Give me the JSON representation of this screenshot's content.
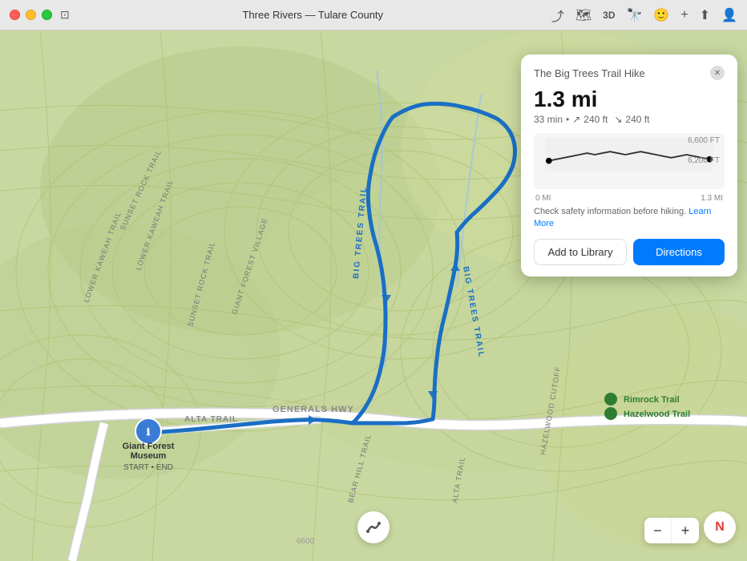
{
  "titlebar": {
    "title": "Three Rivers — Tulare County",
    "window_icon": "📄"
  },
  "toolbar": {
    "icons": [
      "location-arrow",
      "map-icon",
      "3d-icon",
      "binoculars-icon",
      "face-icon",
      "add-icon",
      "share-icon",
      "account-icon"
    ]
  },
  "info_panel": {
    "title": "The Big Trees Trail Hike",
    "distance": "1.3 mi",
    "duration": "33 min",
    "elevation_up": "240 ft",
    "elevation_down": "240 ft",
    "elevation_high_label": "6,600 FT",
    "elevation_low_label": "6,200 FT",
    "distance_start": "0 MI",
    "distance_end": "1.3 MI",
    "safety_text": "Check safety information before hiking.",
    "learn_more": "Learn More",
    "add_to_library_label": "Add to Library",
    "directions_label": "Directions"
  },
  "map": {
    "trail_labels": [
      "BIG TREES TRAIL",
      "ALTA TRAIL",
      "GENERALS HWY",
      "LOWER KAWEAH TRAIL",
      "SUNSET ROCK TRAIL",
      "BEAR HILL TRAIL"
    ],
    "poi": [
      {
        "name": "Giant Forest Museum",
        "sub": "START • END"
      },
      {
        "name": "Rimrock Trail",
        "color": "#2e7d32"
      },
      {
        "name": "Hazelwood Trail",
        "color": "#2e7d32"
      }
    ]
  },
  "bottom_controls": {
    "zoom_minus": "−",
    "zoom_plus": "+",
    "compass_label": "N"
  }
}
